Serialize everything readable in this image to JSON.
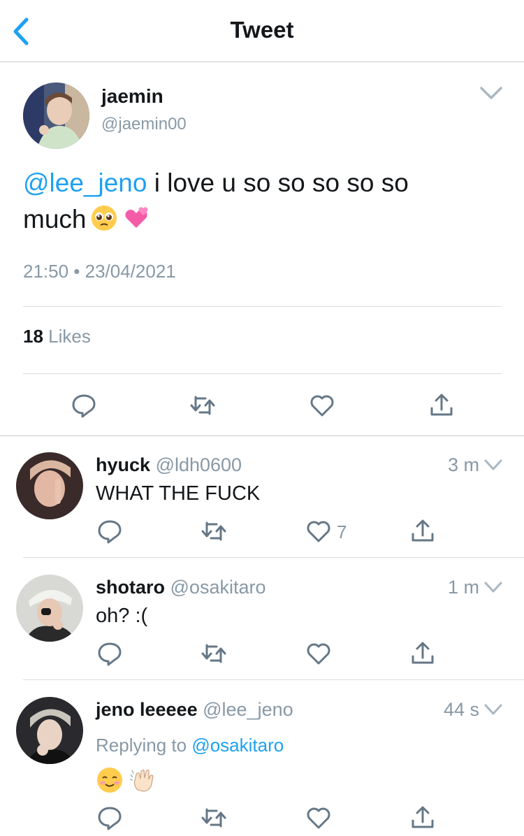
{
  "header": {
    "title": "Tweet"
  },
  "main_tweet": {
    "name": "jaemin",
    "handle": "@jaemin00",
    "mention": "@lee_jeno",
    "text_line1": " i love u so so so so so",
    "text_line2": "much",
    "emojis": [
      "pleading-face",
      "two-hearts"
    ],
    "timestamp": "21:50 • 23/04/2021",
    "likes_count": "18",
    "likes_label": "Likes"
  },
  "replies": [
    {
      "name": "hyuck",
      "handle": "@ldh0600",
      "time": "3 m",
      "text": "WHAT THE FUCK",
      "like_count": "7"
    },
    {
      "name": "shotaro",
      "handle": "@osakitaro",
      "time": "1 m",
      "text": "oh? :("
    },
    {
      "name": "jeno leeeee",
      "handle": "@lee_jeno",
      "time": "44 s",
      "replying_label": "Replying to",
      "replying_to": "@osakitaro",
      "emojis": [
        "smiling-face",
        "waving-hand"
      ]
    }
  ],
  "colors": {
    "accent": "#1da1f2",
    "muted": "#8899a6",
    "text": "#14171a",
    "divider": "#d9dde1"
  }
}
